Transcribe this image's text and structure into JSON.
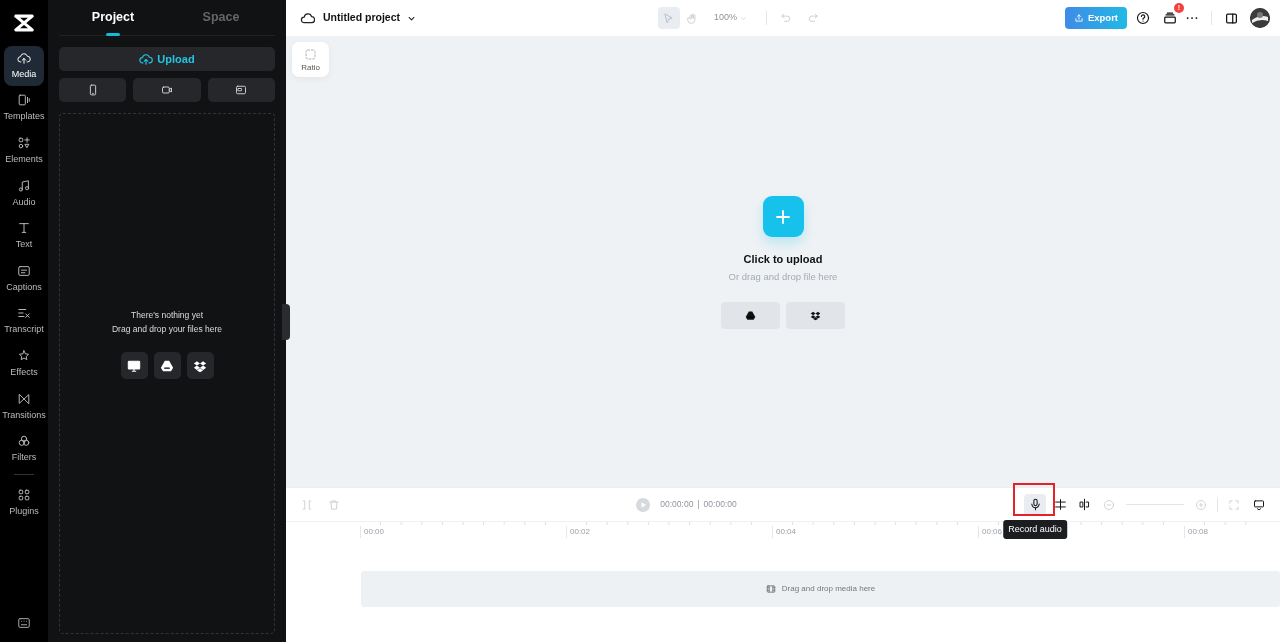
{
  "rail": {
    "items": [
      {
        "label": "Media",
        "selected": true
      },
      {
        "label": "Templates",
        "selected": false
      },
      {
        "label": "Elements",
        "selected": false
      },
      {
        "label": "Audio",
        "selected": false
      },
      {
        "label": "Text",
        "selected": false
      },
      {
        "label": "Captions",
        "selected": false
      },
      {
        "label": "Transcript",
        "selected": false
      },
      {
        "label": "Effects",
        "selected": false
      },
      {
        "label": "Transitions",
        "selected": false
      },
      {
        "label": "Filters",
        "selected": false
      },
      {
        "label": "Plugins",
        "selected": false
      }
    ]
  },
  "panel": {
    "tabs": [
      {
        "label": "Project",
        "selected": true
      },
      {
        "label": "Space",
        "selected": false
      }
    ],
    "upload_button": "Upload",
    "empty_title": "There's nothing yet",
    "empty_hint": "Drag and drop your files here"
  },
  "topbar": {
    "project_title": "Untitled project",
    "zoom": "100%",
    "export_button": "Export",
    "notification_badge": "!"
  },
  "canvas": {
    "ratio_button": "Ratio",
    "upload_title": "Click to upload",
    "upload_hint": "Or drag and drop file here"
  },
  "timeline": {
    "current_time": "00:00:00",
    "time_separator": "|",
    "total_time": "00:00:00",
    "tooltip": "Record audio",
    "ruler": [
      "00:00",
      "00:02",
      "00:04",
      "00:06",
      "00:08"
    ],
    "track_hint": "Drag and drop media here"
  }
}
